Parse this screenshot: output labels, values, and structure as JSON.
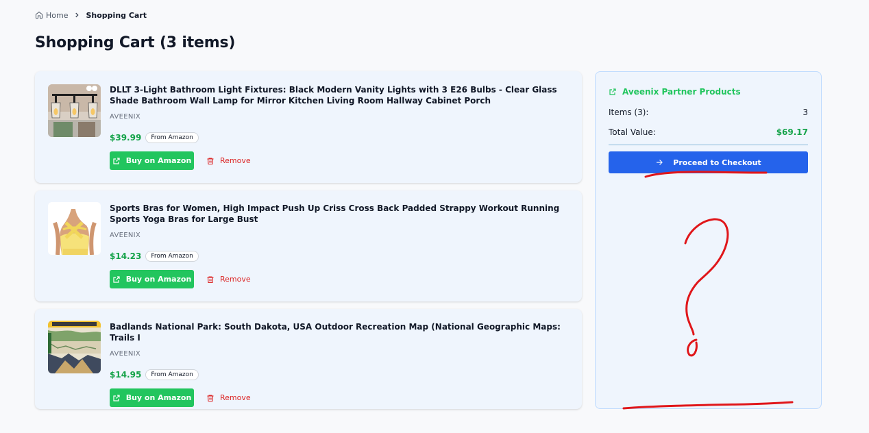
{
  "breadcrumb": {
    "home": "Home",
    "current": "Shopping Cart"
  },
  "page": {
    "title": "Shopping Cart (3 items)"
  },
  "items": [
    {
      "title": "DLLT 3-Light Bathroom Light Fixtures: Black Modern Vanity Lights with 3 E26 Bulbs - Clear Glass Shade Bathroom Wall Lamp for Mirror Kitchen Living Room Hallway Cabinet Porch",
      "brand": "AVEENIX",
      "price": "$39.99",
      "source": "From Amazon",
      "buy_label": "Buy on Amazon",
      "remove_label": "Remove"
    },
    {
      "title": "Sports Bras for Women, High Impact Push Up Criss Cross Back Padded Strappy Workout Running Sports Yoga Bras for Large Bust",
      "brand": "AVEENIX",
      "price": "$14.23",
      "source": "From Amazon",
      "buy_label": "Buy on Amazon",
      "remove_label": "Remove"
    },
    {
      "title": "Badlands National Park: South Dakota, USA Outdoor Recreation Map (National Geographic Maps: Trails I",
      "brand": "AVEENIX",
      "price": "$14.95",
      "source": "From Amazon",
      "buy_label": "Buy on Amazon",
      "remove_label": "Remove"
    }
  ],
  "summary": {
    "heading": "Aveenix Partner Products",
    "items_label": "Items (3):",
    "items_value": "3",
    "total_label": "Total Value:",
    "total_value": "$69.17",
    "checkout_label": "Proceed to Checkout"
  },
  "colors": {
    "accent_green": "#22c55e",
    "price_green": "#16a34a",
    "checkout_blue": "#2563eb",
    "remove_red": "#dc2626",
    "annotation_red": "#e0161a",
    "card_bg": "#eff5fd"
  },
  "icons": {
    "breadcrumb_home": "home-icon",
    "breadcrumb_separator": "chevron-right-icon",
    "buy": "external-link-icon",
    "remove": "trash-icon",
    "summary_heading": "external-link-icon",
    "checkout": "arrow-right-icon"
  }
}
